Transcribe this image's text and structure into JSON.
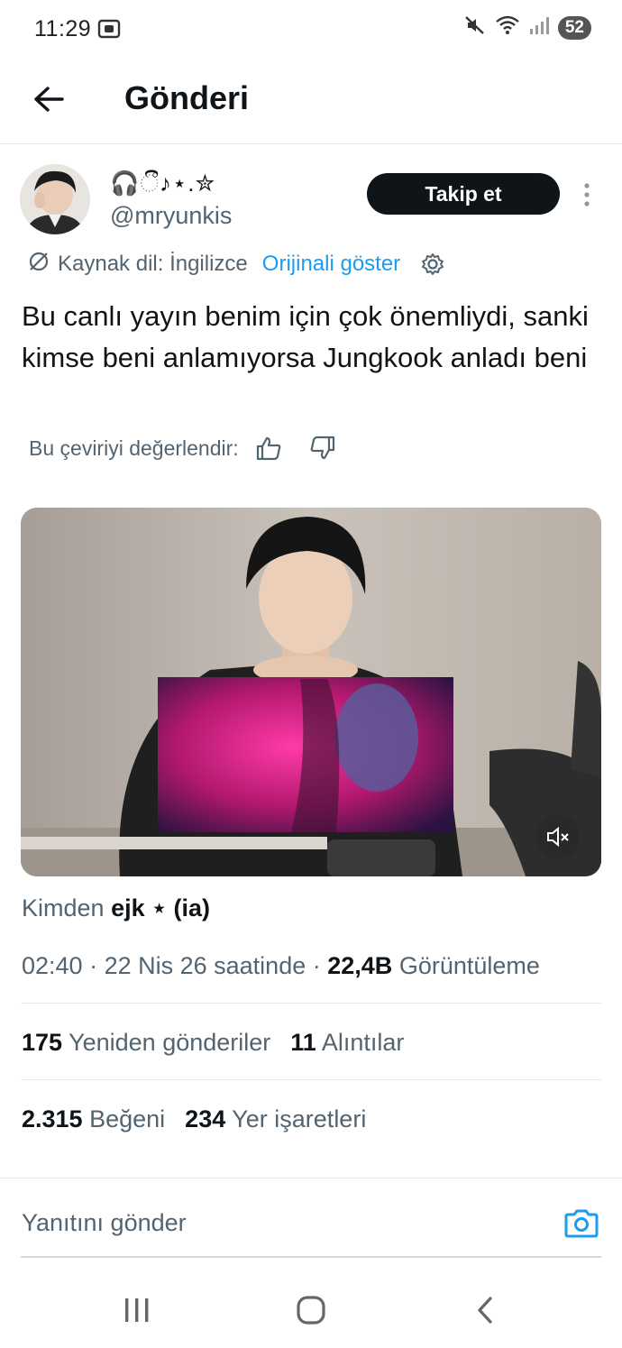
{
  "status_bar": {
    "time": "11:29",
    "battery": "52",
    "icons": [
      "screenshot-icon",
      "mute-icon",
      "wifi-icon",
      "signal-icon",
      "battery-icon"
    ]
  },
  "header": {
    "title": "Gönderi",
    "back_icon": "arrow-left-icon"
  },
  "author": {
    "display_name": "🎧ීී♪⋆.✮",
    "handle": "@mryunkis",
    "follow_label": "Takip et"
  },
  "translation": {
    "source_label": "Kaynak dil: İngilizce",
    "show_original_label": "Orijinali göster",
    "rate_label": "Bu çeviriyi değerlendir:"
  },
  "tweet": {
    "text": "Bu canlı yayın benim için çok önemliydi, sanki kimse beni anlamıyorsa Jungkook anladı beni"
  },
  "media": {
    "kind": "video",
    "muted": true
  },
  "source": {
    "prefix": "Kimden",
    "name": "ejk ⋆ (ia)"
  },
  "meta": {
    "time": "02:40",
    "date": "22 Nis 26 saatinde",
    "views_count": "22,4B",
    "views_label": "Görüntüleme"
  },
  "stats": {
    "reposts_count": "175",
    "reposts_label": "Yeniden gönderiler",
    "quotes_count": "11",
    "quotes_label": "Alıntılar",
    "likes_count": "2.315",
    "likes_label": "Beğeni",
    "bookmarks_count": "234",
    "bookmarks_label": "Yer işaretleri"
  },
  "reply": {
    "placeholder": "Yanıtını gönder"
  },
  "colors": {
    "accent": "#1d9bf0",
    "text": "#0f1419",
    "secondary": "#536471",
    "divider": "#e6e9eb"
  }
}
